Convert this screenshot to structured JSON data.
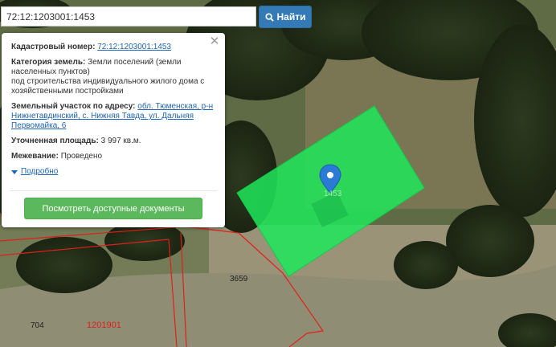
{
  "search": {
    "value": "72:12:1203001:1453",
    "button_label": "Найти"
  },
  "popup": {
    "cadastral_label": "Кадастровый номер:",
    "cadastral_value": "72:12:1203001:1453",
    "category_label": "Категория земель:",
    "category_value_1": "Земли поселений (земли",
    "category_value_2": "населенных пунктов)",
    "category_value_3": "под строительства индивидуального жилого дома с",
    "category_value_4": "хозяйственными постройками",
    "address_label": "Земельный участок по адресу:",
    "address_value_1": "обл. Тюменская, р-н",
    "address_value_2": "Нижнетавдинский, с. Нижняя Тавда, ул. Дальняя",
    "address_value_3": "Первомайка, 6",
    "area_label": "Уточненная площадь:",
    "area_value": "3 997 кв.м.",
    "survey_label": "Межевание:",
    "survey_value": "Проведено",
    "more_label": "Подробно",
    "docs_button": "Посмотреть доступные документы",
    "close_icon": "close-icon"
  },
  "map": {
    "plot_number": "1453",
    "neighbor_number": "3659",
    "label_704": "704",
    "label_quarter": "1201901",
    "highlight_color": "#1fe85a",
    "boundary_color": "#e0201a",
    "marker_color": "#2b7bd6"
  }
}
